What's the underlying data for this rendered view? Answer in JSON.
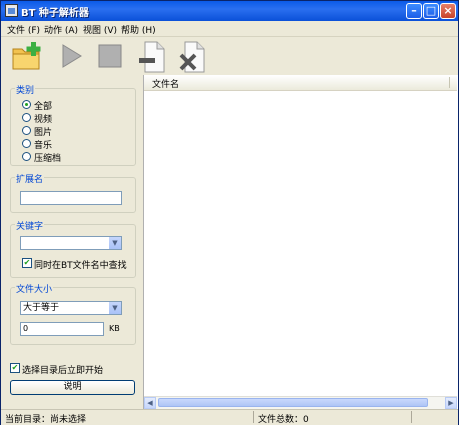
{
  "window": {
    "title": "BT 种子解析器",
    "controls": [
      "minimize-icon",
      "maximize-icon",
      "close-icon"
    ]
  },
  "menu": {
    "items": [
      "文件 (F)",
      "动作 (A)",
      "视图 (V)",
      "帮助 (H)"
    ]
  },
  "toolbar": {
    "tools": [
      {
        "name": "open-folder",
        "icon": "folder-add-icon"
      },
      {
        "name": "start",
        "icon": "play-icon"
      },
      {
        "name": "stop",
        "icon": "stop-icon"
      },
      {
        "name": "remove",
        "icon": "document-minus-icon"
      },
      {
        "name": "delete",
        "icon": "document-x-icon"
      }
    ]
  },
  "category": {
    "title": "类别",
    "options": [
      "全部",
      "视频",
      "图片",
      "音乐",
      "压缩档"
    ],
    "selected": "全部"
  },
  "extension": {
    "title": "扩展名",
    "value": ""
  },
  "keyword": {
    "title": "关键字",
    "value": "",
    "also_search_label": "同时在BT文件名中查找",
    "also_search_checked": true
  },
  "filesize": {
    "title": "文件大小",
    "comparator": "大于等于",
    "value": "0",
    "unit": "KB"
  },
  "start_after_select": {
    "label": "选择目录后立即开始",
    "checked": true
  },
  "help_button": "说明",
  "file_list": {
    "columns": [
      "文件名"
    ],
    "rows": []
  },
  "status": {
    "current_dir": "当前目录：尚未选择",
    "file_total": "文件总数：0"
  },
  "colors": {
    "title_bar": "#0b5be8",
    "group_title": "#0046d5",
    "window_bg": "#ece9d8"
  }
}
